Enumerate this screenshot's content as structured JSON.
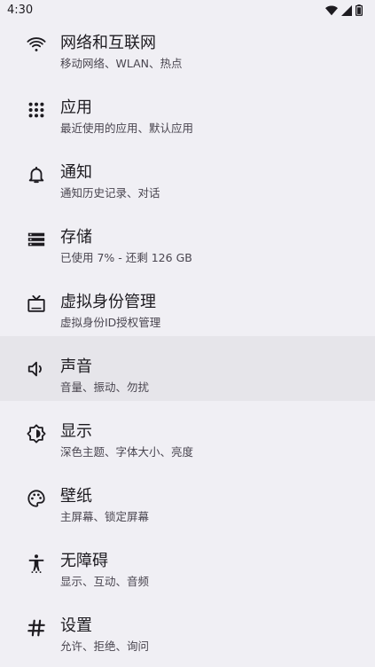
{
  "status_bar": {
    "time": "4:30",
    "icons": [
      "wifi-icon",
      "signal-icon",
      "battery-icon"
    ]
  },
  "settings": [
    {
      "title": "网络和互联网",
      "subtitle": "移动网络、WLAN、热点",
      "icon": "wifi-icon"
    },
    {
      "title": "应用",
      "subtitle": "最近使用的应用、默认应用",
      "icon": "apps-grid-icon"
    },
    {
      "title": "通知",
      "subtitle": "通知历史记录、对话",
      "icon": "bell-icon"
    },
    {
      "title": "存储",
      "subtitle": "已使用 7% - 还剩 126 GB",
      "icon": "storage-icon"
    },
    {
      "title": "虚拟身份管理",
      "subtitle": "虚拟身份ID授权管理",
      "icon": "tv-icon"
    },
    {
      "title": "声音",
      "subtitle": "音量、振动、勿扰",
      "icon": "speaker-icon",
      "selected": true
    },
    {
      "title": "显示",
      "subtitle": "深色主题、字体大小、亮度",
      "icon": "brightness-icon"
    },
    {
      "title": "壁纸",
      "subtitle": "主屏幕、锁定屏幕",
      "icon": "palette-icon"
    },
    {
      "title": "无障碍",
      "subtitle": "显示、互动、音频",
      "icon": "accessibility-icon"
    },
    {
      "title": "设置",
      "subtitle": "允许、拒绝、询问",
      "icon": "hash-icon"
    }
  ],
  "colors": {
    "background": "#f0eff4",
    "selected_row": "#e6e5ea",
    "text_primary": "#1d1b20",
    "text_secondary": "#49454f"
  }
}
